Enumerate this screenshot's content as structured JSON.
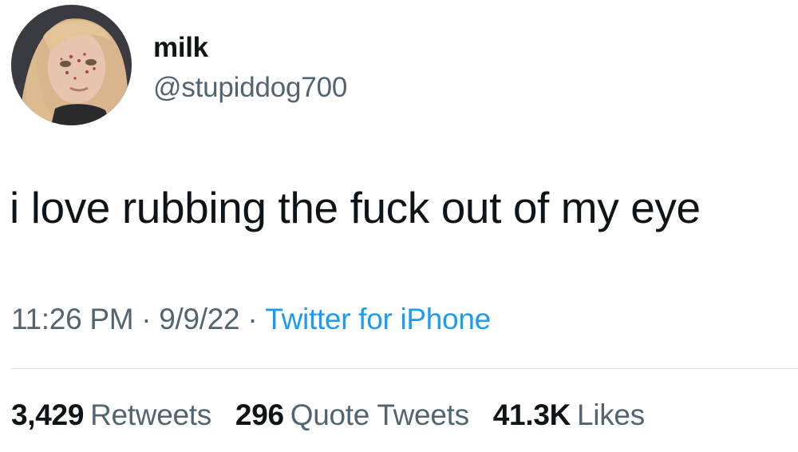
{
  "author": {
    "name": "milk",
    "handle": "@stupiddog700"
  },
  "tweet": {
    "text": "i love rubbing the fuck out of my eye",
    "time": "11:26 PM",
    "date": "9/9/22",
    "separator": "·",
    "source": "Twitter for iPhone"
  },
  "stats": {
    "retweets_count": "3,429",
    "retweets_label": "Retweets",
    "quotes_count": "296",
    "quotes_label": "Quote Tweets",
    "likes_count": "41.3K",
    "likes_label": "Likes"
  },
  "colors": {
    "text": "#0f1419",
    "secondary": "#536471",
    "link": "#1d9bf0",
    "divider": "#dfe3e6"
  }
}
